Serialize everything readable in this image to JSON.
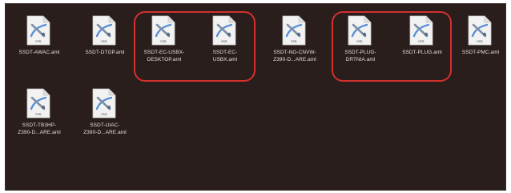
{
  "colors": {
    "background": "#2a1e1c",
    "label_text": "#e7dfdc",
    "highlight_outline": "#d2312d",
    "icon_paper": "#f2f2f2",
    "icon_accent": "#5a8fd6"
  },
  "icon_name": "aml-document-icon",
  "icon_tag": "AML",
  "files": [
    {
      "name": "SSDT-AWAC.aml"
    },
    {
      "name": "SSDT-DTGP.aml"
    },
    {
      "name": "SSDT-EC-USBX-\nDESKTOP.aml"
    },
    {
      "name": "SSDT-EC-\nUSBX.aml"
    },
    {
      "name": "SSDT-NO-CNVW-\nZ390-D...ARE.aml"
    },
    {
      "name": "SSDT-PLUG-\nDRTNIA.aml"
    },
    {
      "name": "SSDT-PLUG.aml"
    },
    {
      "name": "SSDT-PMC.aml"
    },
    {
      "name": "SSDT-TB3HP-\nZ390-D...ARE.aml"
    },
    {
      "name": "SSDT-UIAC-\nZ390-D...ARE.aml"
    }
  ]
}
